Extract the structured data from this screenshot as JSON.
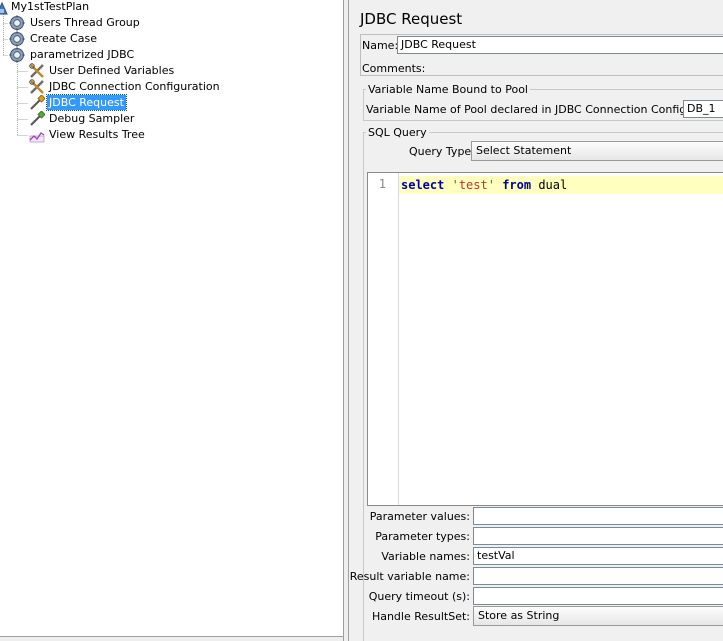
{
  "tree": {
    "items": [
      {
        "label": "My1stTestPlan",
        "icon": "test-plan-icon"
      },
      {
        "label": "Users Thread Group",
        "icon": "thread-group-gear-icon"
      },
      {
        "label": "Create Case",
        "icon": "thread-group-gear-icon"
      },
      {
        "label": "parametrized JDBC",
        "icon": "thread-group-gear-icon"
      },
      {
        "label": "User Defined Variables",
        "icon": "config-tools-icon"
      },
      {
        "label": "JDBC Connection Configuration",
        "icon": "config-tools-icon"
      },
      {
        "label": "JDBC Request",
        "icon": "sampler-pipette-icon",
        "selected": true
      },
      {
        "label": "Debug Sampler",
        "icon": "sampler-pipette-icon"
      },
      {
        "label": "View Results Tree",
        "icon": "listener-graph-icon"
      }
    ]
  },
  "editor": {
    "title": "JDBC Request",
    "name_label": "Name:",
    "name_value": "JDBC Request",
    "comments_label": "Comments:",
    "pool_group_title": "Variable Name Bound to Pool",
    "pool_label": "Variable Name of Pool declared in JDBC Connection Configuration:",
    "pool_value": "DB_1",
    "sql_group_title": "SQL Query",
    "query_type_label": "Query Type:",
    "query_type_value": "Select Statement",
    "code": {
      "line_number": "1",
      "kw_select": "select",
      "str_test": "'test'",
      "kw_from": "from",
      "ident_dual": "dual"
    },
    "params": {
      "values_label": "Parameter values:",
      "values_value": "",
      "types_label": "Parameter types:",
      "types_value": "",
      "varnames_label": "Variable names:",
      "varnames_value": "testVal",
      "resultvar_label": "Result variable name:",
      "resultvar_value": "",
      "timeout_label": "Query timeout (s):",
      "timeout_value": "",
      "resultset_label": "Handle ResultSet:",
      "resultset_value": "Store as String"
    }
  },
  "colors": {
    "selection": "#3399ff",
    "keyword": "#0000a0",
    "string": "#c03030",
    "current_line": "#ffffbf",
    "panel_bg": "#f0f0f0"
  }
}
